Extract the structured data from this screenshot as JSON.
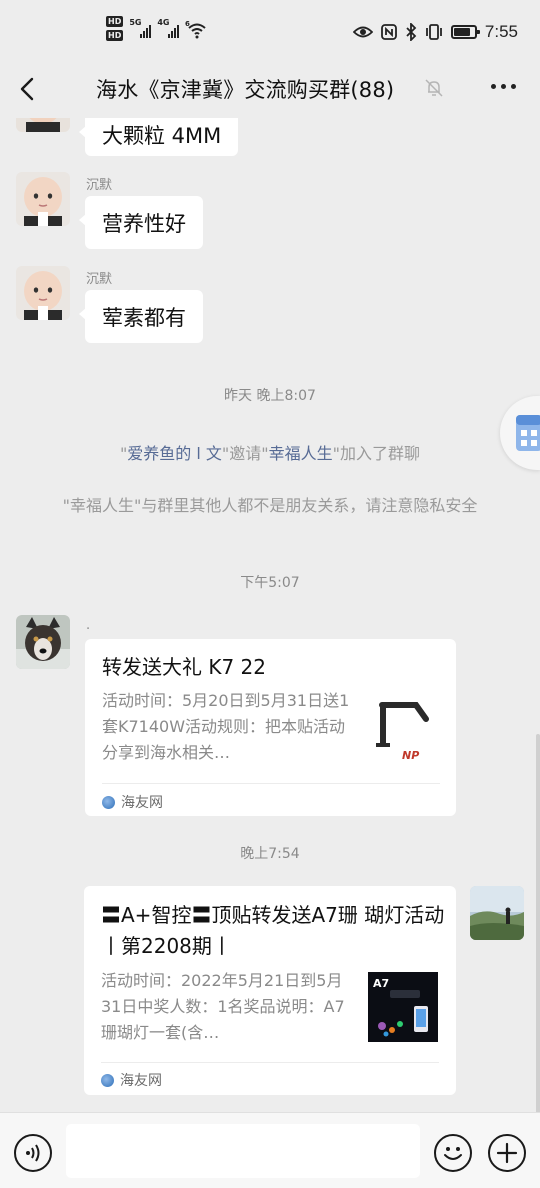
{
  "status_bar": {
    "hd_top": "HD",
    "hd_bottom": "HD",
    "net1": "5G",
    "net2": "4G",
    "wifi_tag": "6",
    "time": "7:55",
    "icons": [
      "eye-icon",
      "nfc-icon",
      "bluetooth-icon",
      "vibrate-icon",
      "battery-icon"
    ],
    "battery_level": 0.8
  },
  "header": {
    "title": "海水《京津冀》交流购买群(88)",
    "muted": true
  },
  "messages": {
    "m0": {
      "text": "大颗粒 4MM"
    },
    "m1": {
      "sender": "沉默",
      "text": "营养性好"
    },
    "m2": {
      "sender": "沉默",
      "text": "荤素都有"
    },
    "ts1": "昨天 晚上8:07",
    "sys_invite": {
      "q1": "\"",
      "inviter": "爱养鱼的 l 文",
      "mid": "\"邀请\"",
      "invitee": "幸福人生",
      "tail": "\"加入了群聊"
    },
    "sys_warn": "\"幸福人生\"与群里其他人都不是朋友关系，请注意隐私安全",
    "ts2": "下午5:07",
    "card1": {
      "sender": ".",
      "title": "转发送大礼 K7 22",
      "desc": "活动时间：5月20日到5月31日送1套K7140W活动规则：把本贴活动分享到海水相关…",
      "source": "海友网"
    },
    "ts3": "晚上7:54",
    "card2": {
      "title": "〓A+智控〓顶贴转发送A7珊 瑚灯活动丨第2208期丨",
      "desc": "活动时间：2022年5月21日到5月31日中奖人数：1名奖品说明：A7珊瑚灯一套(含…",
      "source": "海友网",
      "thumb_label": "A7"
    }
  },
  "input_bar": {
    "placeholder": ""
  }
}
